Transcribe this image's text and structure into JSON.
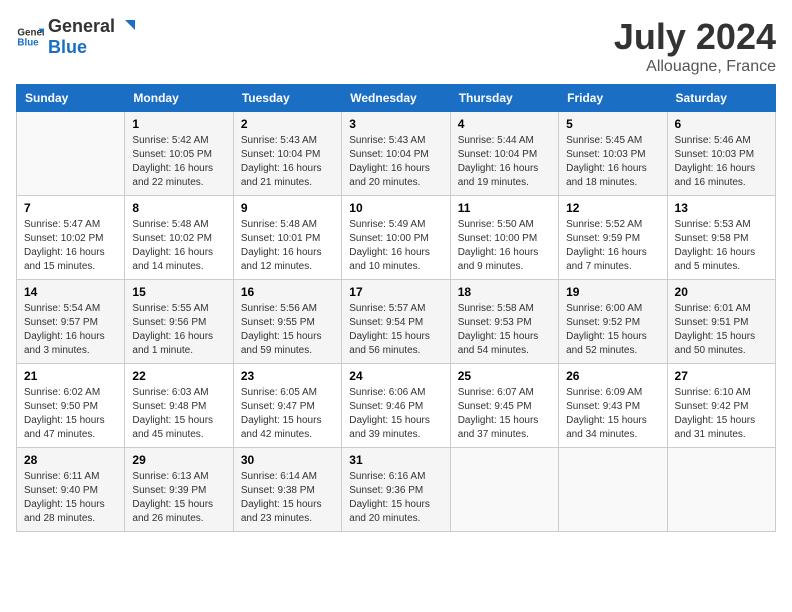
{
  "header": {
    "logo_general": "General",
    "logo_blue": "Blue",
    "month_year": "July 2024",
    "location": "Allouagne, France"
  },
  "columns": [
    "Sunday",
    "Monday",
    "Tuesday",
    "Wednesday",
    "Thursday",
    "Friday",
    "Saturday"
  ],
  "weeks": [
    [
      {
        "day": "",
        "info": ""
      },
      {
        "day": "1",
        "info": "Sunrise: 5:42 AM\nSunset: 10:05 PM\nDaylight: 16 hours\nand 22 minutes."
      },
      {
        "day": "2",
        "info": "Sunrise: 5:43 AM\nSunset: 10:04 PM\nDaylight: 16 hours\nand 21 minutes."
      },
      {
        "day": "3",
        "info": "Sunrise: 5:43 AM\nSunset: 10:04 PM\nDaylight: 16 hours\nand 20 minutes."
      },
      {
        "day": "4",
        "info": "Sunrise: 5:44 AM\nSunset: 10:04 PM\nDaylight: 16 hours\nand 19 minutes."
      },
      {
        "day": "5",
        "info": "Sunrise: 5:45 AM\nSunset: 10:03 PM\nDaylight: 16 hours\nand 18 minutes."
      },
      {
        "day": "6",
        "info": "Sunrise: 5:46 AM\nSunset: 10:03 PM\nDaylight: 16 hours\nand 16 minutes."
      }
    ],
    [
      {
        "day": "7",
        "info": "Sunrise: 5:47 AM\nSunset: 10:02 PM\nDaylight: 16 hours\nand 15 minutes."
      },
      {
        "day": "8",
        "info": "Sunrise: 5:48 AM\nSunset: 10:02 PM\nDaylight: 16 hours\nand 14 minutes."
      },
      {
        "day": "9",
        "info": "Sunrise: 5:48 AM\nSunset: 10:01 PM\nDaylight: 16 hours\nand 12 minutes."
      },
      {
        "day": "10",
        "info": "Sunrise: 5:49 AM\nSunset: 10:00 PM\nDaylight: 16 hours\nand 10 minutes."
      },
      {
        "day": "11",
        "info": "Sunrise: 5:50 AM\nSunset: 10:00 PM\nDaylight: 16 hours\nand 9 minutes."
      },
      {
        "day": "12",
        "info": "Sunrise: 5:52 AM\nSunset: 9:59 PM\nDaylight: 16 hours\nand 7 minutes."
      },
      {
        "day": "13",
        "info": "Sunrise: 5:53 AM\nSunset: 9:58 PM\nDaylight: 16 hours\nand 5 minutes."
      }
    ],
    [
      {
        "day": "14",
        "info": "Sunrise: 5:54 AM\nSunset: 9:57 PM\nDaylight: 16 hours\nand 3 minutes."
      },
      {
        "day": "15",
        "info": "Sunrise: 5:55 AM\nSunset: 9:56 PM\nDaylight: 16 hours\nand 1 minute."
      },
      {
        "day": "16",
        "info": "Sunrise: 5:56 AM\nSunset: 9:55 PM\nDaylight: 15 hours\nand 59 minutes."
      },
      {
        "day": "17",
        "info": "Sunrise: 5:57 AM\nSunset: 9:54 PM\nDaylight: 15 hours\nand 56 minutes."
      },
      {
        "day": "18",
        "info": "Sunrise: 5:58 AM\nSunset: 9:53 PM\nDaylight: 15 hours\nand 54 minutes."
      },
      {
        "day": "19",
        "info": "Sunrise: 6:00 AM\nSunset: 9:52 PM\nDaylight: 15 hours\nand 52 minutes."
      },
      {
        "day": "20",
        "info": "Sunrise: 6:01 AM\nSunset: 9:51 PM\nDaylight: 15 hours\nand 50 minutes."
      }
    ],
    [
      {
        "day": "21",
        "info": "Sunrise: 6:02 AM\nSunset: 9:50 PM\nDaylight: 15 hours\nand 47 minutes."
      },
      {
        "day": "22",
        "info": "Sunrise: 6:03 AM\nSunset: 9:48 PM\nDaylight: 15 hours\nand 45 minutes."
      },
      {
        "day": "23",
        "info": "Sunrise: 6:05 AM\nSunset: 9:47 PM\nDaylight: 15 hours\nand 42 minutes."
      },
      {
        "day": "24",
        "info": "Sunrise: 6:06 AM\nSunset: 9:46 PM\nDaylight: 15 hours\nand 39 minutes."
      },
      {
        "day": "25",
        "info": "Sunrise: 6:07 AM\nSunset: 9:45 PM\nDaylight: 15 hours\nand 37 minutes."
      },
      {
        "day": "26",
        "info": "Sunrise: 6:09 AM\nSunset: 9:43 PM\nDaylight: 15 hours\nand 34 minutes."
      },
      {
        "day": "27",
        "info": "Sunrise: 6:10 AM\nSunset: 9:42 PM\nDaylight: 15 hours\nand 31 minutes."
      }
    ],
    [
      {
        "day": "28",
        "info": "Sunrise: 6:11 AM\nSunset: 9:40 PM\nDaylight: 15 hours\nand 28 minutes."
      },
      {
        "day": "29",
        "info": "Sunrise: 6:13 AM\nSunset: 9:39 PM\nDaylight: 15 hours\nand 26 minutes."
      },
      {
        "day": "30",
        "info": "Sunrise: 6:14 AM\nSunset: 9:38 PM\nDaylight: 15 hours\nand 23 minutes."
      },
      {
        "day": "31",
        "info": "Sunrise: 6:16 AM\nSunset: 9:36 PM\nDaylight: 15 hours\nand 20 minutes."
      },
      {
        "day": "",
        "info": ""
      },
      {
        "day": "",
        "info": ""
      },
      {
        "day": "",
        "info": ""
      }
    ]
  ]
}
